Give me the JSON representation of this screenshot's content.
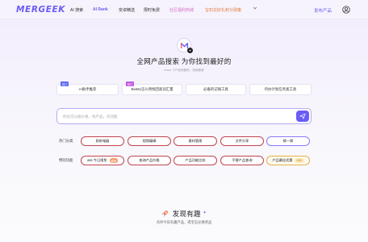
{
  "header": {
    "logo": "MERGEEK",
    "nav": [
      {
        "label": "AI 搜索"
      },
      {
        "label": "AI Rank"
      },
      {
        "label": "安卓精选"
      },
      {
        "label": "限时免费"
      },
      {
        "label": "社区福利商城"
      },
      {
        "label": "宝石兑好礼积分政策"
      }
    ],
    "more_icon": "chevron-down-icon",
    "publish": "发布产品",
    "user_icon": "user-circle-icon"
  },
  "hero": {
    "title": "全网产品搜索 为你找到最好的",
    "subtitle": "xxxxx 个产品和服务，持续更新",
    "suggestions": [
      {
        "tag": "热门",
        "label": "AI助手推荐"
      },
      {
        "tag": "热门",
        "label": "BiaMo怎么用找回高词汇量"
      },
      {
        "tag": "",
        "label": "必备的记账工具"
      },
      {
        "tag": "",
        "label": "待办计划任务类工具"
      }
    ],
    "search_placeholder": "你也可以搜价格，找产品，问功能"
  },
  "hot_categories": {
    "label": "热门分类",
    "items": [
      "厨房电器",
      "视频编辑",
      "素材管理",
      "文件分享",
      "换一换"
    ]
  },
  "special_features": {
    "label": "特别功能",
    "items": [
      {
        "label": "ass 今日限免",
        "badge": "推荐"
      },
      {
        "label": "查询产品价格",
        "badge": ""
      },
      {
        "label": "产品功能比较",
        "badge": ""
      },
      {
        "label": "平替产品查询",
        "badge": ""
      },
      {
        "label": "产品最佳优惠",
        "badge": "199+"
      }
    ]
  },
  "discover": {
    "title": "发现有趣",
    "subtitle": "点评今日有趣产品，得宝石兑换奖品"
  },
  "colors": {
    "accent": "#6a5cf6",
    "red_border": "#c2444f",
    "gold_border": "#e3b04b"
  }
}
